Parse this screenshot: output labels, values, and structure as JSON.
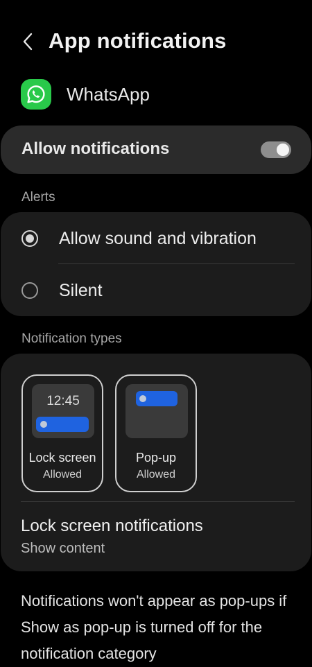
{
  "header": {
    "title": "App notifications"
  },
  "app": {
    "name": "WhatsApp",
    "icon": "whatsapp-icon",
    "icon_color": "#29c94a"
  },
  "allow_notifications": {
    "label": "Allow notifications",
    "enabled": true
  },
  "alerts": {
    "section_label": "Alerts",
    "options": [
      {
        "label": "Allow sound and vibration",
        "selected": true
      },
      {
        "label": "Silent",
        "selected": false
      }
    ]
  },
  "notification_types": {
    "section_label": "Notification types",
    "tiles": [
      {
        "title": "Lock screen",
        "status": "Allowed",
        "preview_time": "12:45"
      },
      {
        "title": "Pop-up",
        "status": "Allowed"
      }
    ],
    "lock_screen_notifications": {
      "title": "Lock screen notifications",
      "value": "Show content"
    }
  },
  "footnote": "Notifications won't appear as pop-ups if Show as pop-up is turned off for the notification category",
  "colors": {
    "background": "#000000",
    "card": "#1c1c1c",
    "allow_card": "#2b2b2b",
    "accent_blue": "#1f63e0",
    "toggle_on": "#8e8e8e"
  }
}
